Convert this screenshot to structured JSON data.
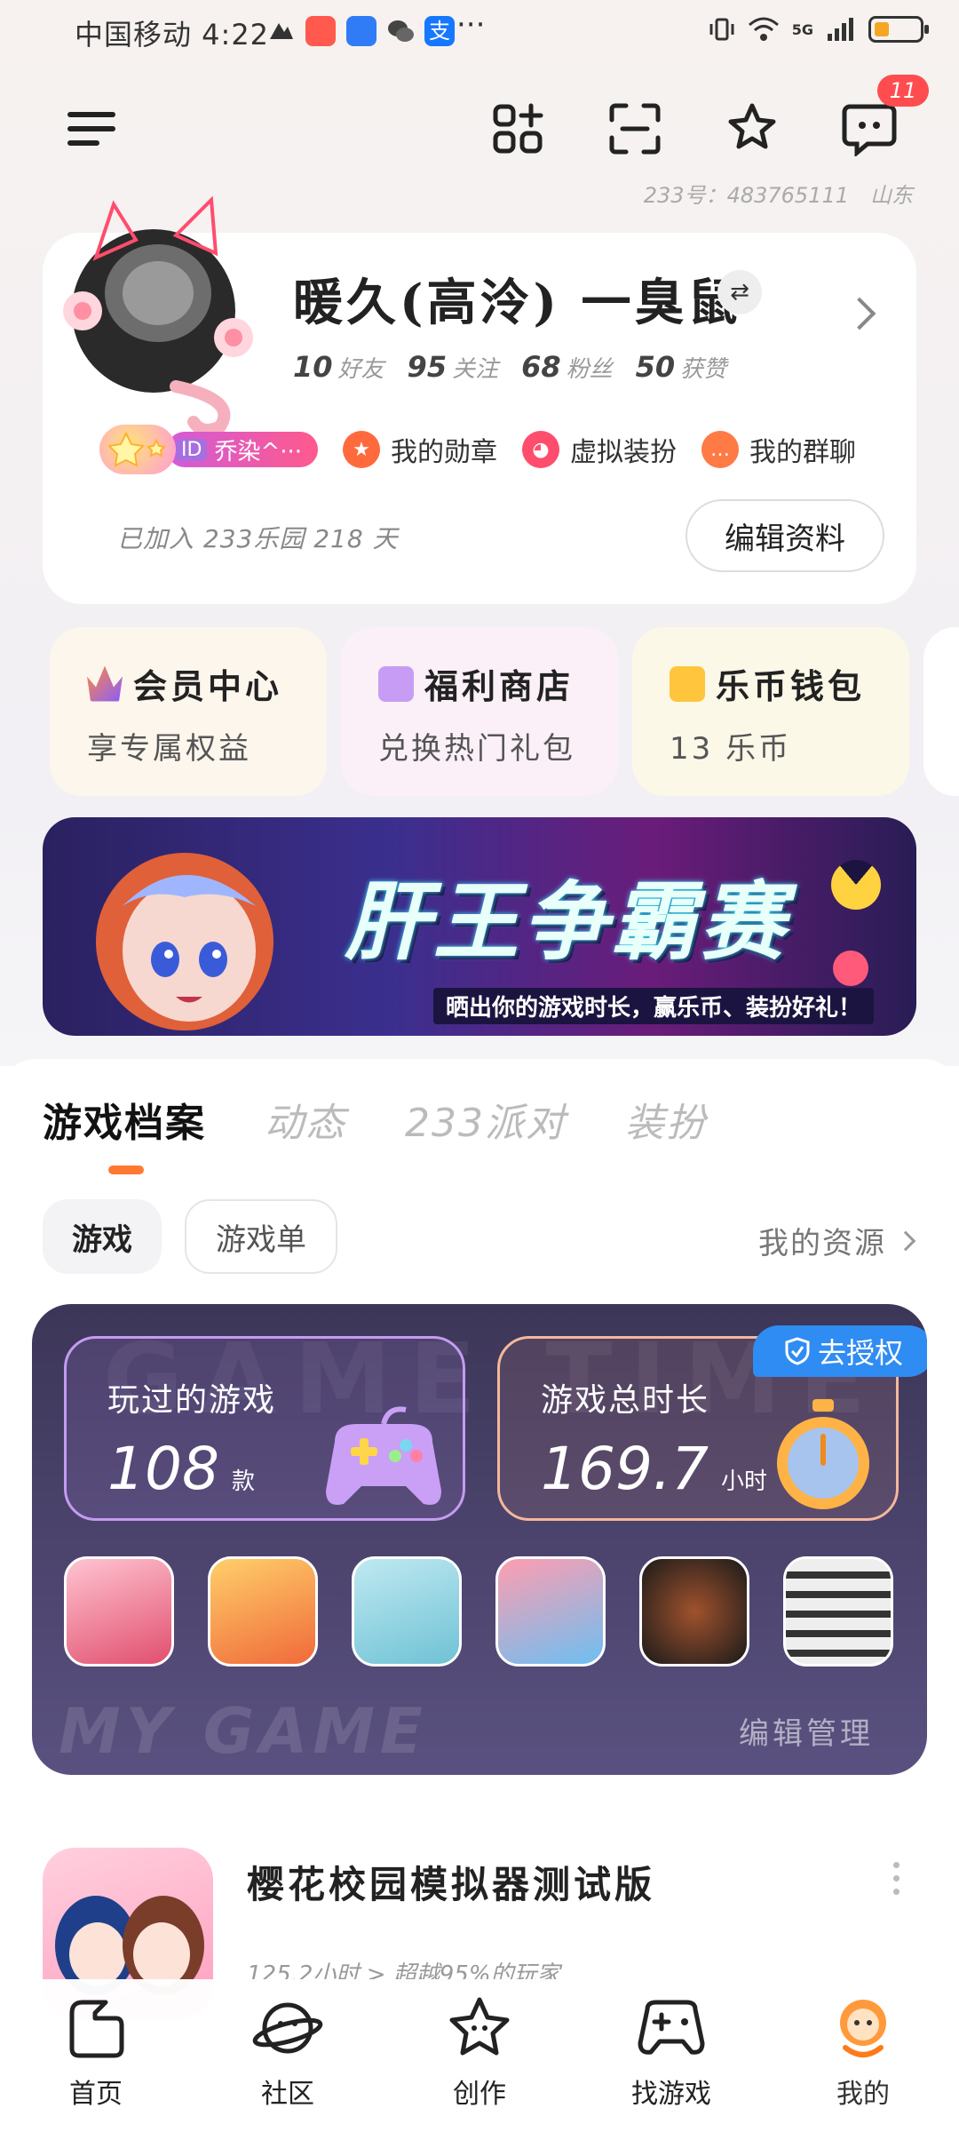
{
  "status_bar": {
    "time": "中国移动 4:22",
    "dots": "···",
    "network": "5G",
    "battery_level": 0.25
  },
  "header": {
    "message_badge": "11",
    "id_label": "233号：",
    "id_value": "483765111",
    "region": "山东"
  },
  "profile": {
    "username": "暖久(高泠) 一臭鼠",
    "stats": [
      {
        "num": "10",
        "label": "好友"
      },
      {
        "num": "95",
        "label": "关注"
      },
      {
        "num": "68",
        "label": "粉丝"
      },
      {
        "num": "50",
        "label": "获赞"
      }
    ],
    "id_tag": "ID",
    "id_text": "乔染^···",
    "entries": [
      {
        "label": "我的勋章",
        "icon": "medal-icon",
        "color": "#ff6a3d"
      },
      {
        "label": "虚拟装扮",
        "icon": "cat-costume-icon",
        "color": "#ff4d6d"
      },
      {
        "label": "我的群聊",
        "icon": "chat-group-icon",
        "color": "#ff7a45"
      }
    ],
    "joined": "已加入 233乐园 218 天",
    "edit_button": "编辑资料"
  },
  "quick_cards": [
    {
      "title": "会员中心",
      "sub": "享专属权益",
      "icon": "crown-icon",
      "bg": "#fdf6ec"
    },
    {
      "title": "福利商店",
      "sub": "兑换热门礼包",
      "icon": "gift-icon",
      "bg": "#fbf0f7"
    },
    {
      "title": "乐币钱包",
      "sub": "13 乐币",
      "icon": "wallet-icon",
      "bg": "#fbf8e8"
    }
  ],
  "banner": {
    "headline": "肝王争霸赛",
    "subtitle": "晒出你的游戏时长，赢乐币、装扮好礼！"
  },
  "tabs": [
    "游戏档案",
    "动态",
    "233派对",
    "装扮"
  ],
  "chips": [
    "游戏",
    "游戏单"
  ],
  "my_resources": "我的资源",
  "game_panel": {
    "watermark_top": "GAME TIME",
    "watermark_bottom": "MY GAME",
    "played_label": "玩过的游戏",
    "played_value": "108",
    "played_unit": "款",
    "duration_label": "游戏总时长",
    "duration_value": "169.7",
    "duration_unit": "小时",
    "auth_label": "去授权",
    "edit_manage": "编辑管理"
  },
  "game_row": {
    "title": "樱花校园模拟器测试版",
    "meta": "125.2小时 > 超越95%的玩家"
  },
  "bottom_nav": [
    {
      "label": "首页",
      "icon": "home-icon"
    },
    {
      "label": "社区",
      "icon": "planet-icon"
    },
    {
      "label": "创作",
      "icon": "star-face-icon"
    },
    {
      "label": "找游戏",
      "icon": "gamepad-icon"
    },
    {
      "label": "我的",
      "icon": "profile-mascot-icon"
    }
  ]
}
